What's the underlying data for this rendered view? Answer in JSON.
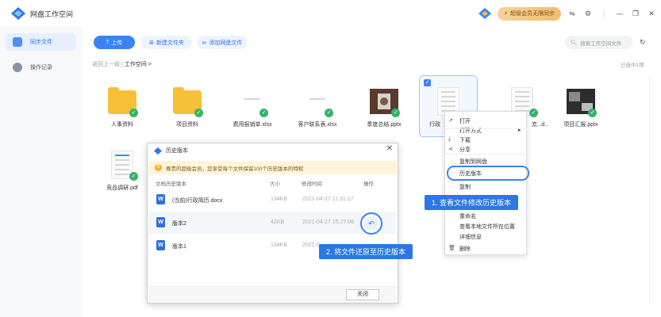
{
  "app": {
    "title": "网盘工作空间",
    "vip_label": "超级会员无限同步"
  },
  "sidebar": {
    "items": [
      {
        "label": "同步文件"
      },
      {
        "label": "操作记录"
      }
    ]
  },
  "toolbar": {
    "upload_label": "上传",
    "new_folder_label": "新建文件夹",
    "add_disk_file_label": "添加网盘文件",
    "search_placeholder": "搜索工作空间文件"
  },
  "breadcrumb": {
    "back": "返回上一级",
    "separator": "|",
    "current": "工作空间",
    "arrow": ">"
  },
  "selection": {
    "text": "已选中1项"
  },
  "files": [
    {
      "name": "人事资料"
    },
    {
      "name": "项目资料"
    },
    {
      "name": "费用报销单.xlsx"
    },
    {
      "name": "客户联系表.xlsx"
    },
    {
      "name": "季度总结.pptx"
    },
    {
      "name": "行政"
    },
    {
      "name": "流...d..."
    },
    {
      "name": "项目汇报.pptx"
    },
    {
      "name": "竞品调研.pdf"
    }
  ],
  "context_menu": {
    "items": [
      {
        "label": "打开"
      },
      {
        "label": "打开方式"
      },
      {
        "label": "下载"
      },
      {
        "label": "分享"
      },
      {
        "label": "复制到网盘"
      },
      {
        "label": "历史版本"
      },
      {
        "label": "复制"
      },
      {
        "label": "重命名"
      },
      {
        "label": "查看本地文件所在位置"
      },
      {
        "label": "详细信息"
      },
      {
        "label": "删除"
      }
    ],
    "highlighted_index": 5
  },
  "callouts": {
    "step1": "1. 查看文件修改历史版本",
    "step2": "2. 将文件还原至历史版本"
  },
  "dialog": {
    "title": "历史版本",
    "notice": "尊贵的超级会员，您享受每个文件保留100个历史版本的特权",
    "columns": {
      "name": "文档历史版本",
      "size": "大小",
      "time": "修改时间",
      "action": "操作"
    },
    "rows": [
      {
        "name": "(当前)行政简历.docx",
        "size": "134KB",
        "time": "2021-04-27 11:31:17"
      },
      {
        "name": "版本2",
        "size": "42KB",
        "time": "2021-04-27 15:27:06"
      },
      {
        "name": "版本1",
        "size": "134KB",
        "time": "2021-0"
      }
    ],
    "close_label": "关闭"
  },
  "colors": {
    "accent": "#3b82f6",
    "folder": "#f6c038",
    "check": "#34b36b"
  }
}
